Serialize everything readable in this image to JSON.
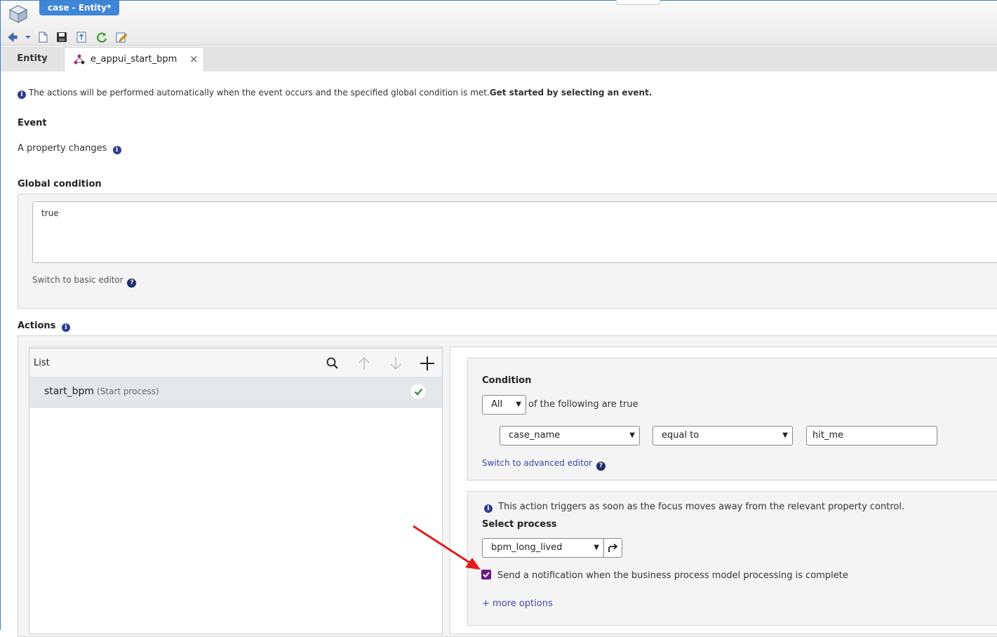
{
  "window": {
    "doc_tab": "case - Entity*"
  },
  "tabs": {
    "entity": "Entity",
    "bpm": "e_appui_start_bpm",
    "close": "×"
  },
  "info": {
    "intro": "The actions will be performed automatically when the event occurs and the specified global condition is met.",
    "intro_bold": "Get started by selecting an event."
  },
  "event": {
    "title": "Event",
    "value": "A property changes"
  },
  "global_condition": {
    "title": "Global condition",
    "expression": "true",
    "switch_label": "Switch to basic editor"
  },
  "actions": {
    "title": "Actions",
    "list": {
      "title": "List",
      "items": [
        {
          "name": "start_bpm",
          "type": "(Start process)"
        }
      ]
    },
    "condition": {
      "title": "Condition",
      "quantifier": "All",
      "suffix": "of the following are true",
      "property": "case_name",
      "operator": "equal to",
      "value": "hit_me",
      "switch_label": "Switch to advanced editor"
    },
    "process": {
      "info": "This action triggers as soon as the focus moves away from the relevant property control.",
      "select_label": "Select process",
      "selected": "bpm_long_lived",
      "notify_label": "Send a notification when the business process model processing is complete",
      "more_options": "+ more options"
    }
  },
  "colors": {
    "accent_blue": "#3f86d6",
    "link": "#3b47a8",
    "checkbox": "#6b1a86",
    "success": "#2e8b2e",
    "arrow": "#e21b1b"
  }
}
